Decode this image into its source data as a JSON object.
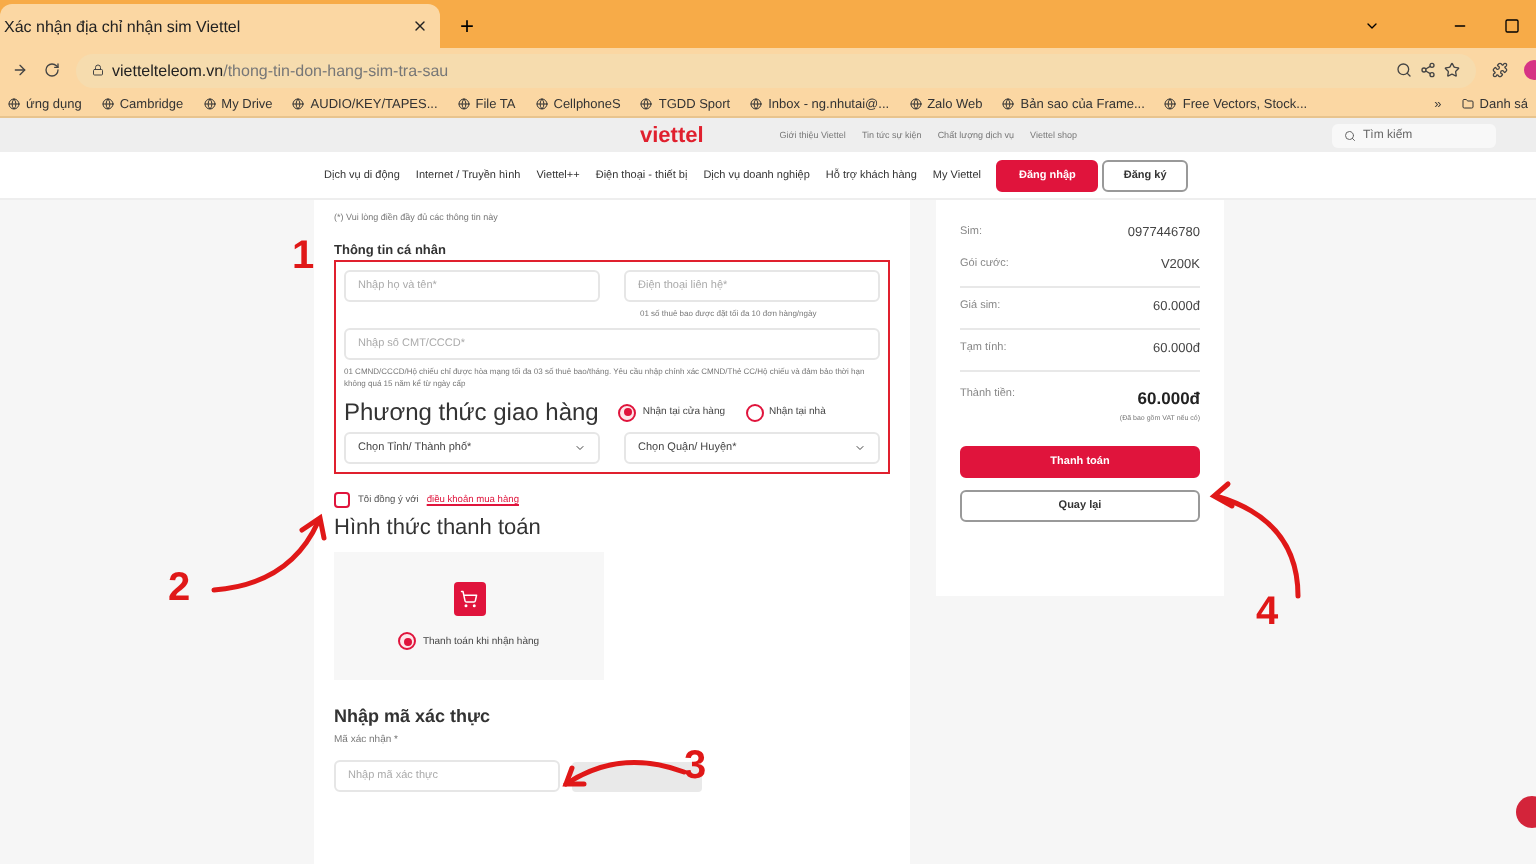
{
  "browser": {
    "tab_title": "Xác nhận địa chỉ nhận sim Viettel",
    "new_tab": "+",
    "url_domain": "viettelteleom.vn",
    "url_path": "/thong-tin-don-hang-sim-tra-sau",
    "bookmarks": [
      "ứng dụng",
      "Cambridge",
      "My Drive",
      "AUDIO/KEY/TAPES...",
      "File TA",
      "CellphoneS",
      "TGDD Sport",
      "Inbox - ng.nhutai@...",
      "Zalo Web",
      "Bản sao của Frame...",
      "Free Vectors, Stock..."
    ],
    "more": "»",
    "other_bookmarks": "Danh sá"
  },
  "header": {
    "logo": "viettel",
    "top_links": [
      "Giới thiệu Viettel",
      "Tin tức sự kiện",
      "Chất lượng dịch vụ",
      "Viettel shop"
    ],
    "search_placeholder": "Tìm kiếm",
    "nav": [
      "Dịch vụ di động",
      "Internet / Truyền hình",
      "Viettel++",
      "Điện thoại - thiết bị",
      "Dịch vụ doanh nghiệp",
      "Hỗ trợ khách hàng",
      "My Viettel"
    ],
    "login": "Đăng nhập",
    "register": "Đăng ký"
  },
  "form": {
    "note": "(*) Vui lòng điền đầy đủ các thông tin này",
    "section_title": "Thông tin cá nhân",
    "name_placeholder": "Nhập họ và tên*",
    "phone_placeholder": "Điện thoại liên hệ*",
    "phone_hint": "01 số thuê bao được đặt tối đa 10 đơn hàng/ngày",
    "id_placeholder": "Nhập số CMT/CCCD*",
    "id_note": "01 CMND/CCCD/Hộ chiếu chỉ được hòa mạng tối đa 03 số thuê bao/tháng. Yêu cầu nhập chính xác CMND/Thẻ CC/Hộ chiếu và đảm bảo thời hạn không quá 15 năm kể từ ngày cấp",
    "delivery_title": "Phương thức giao hàng",
    "delivery_options": [
      {
        "label": "Nhận tại cửa hàng",
        "selected": true
      },
      {
        "label": "Nhận tại nhà",
        "selected": false
      }
    ],
    "selects": [
      "Chọn Tỉnh/ Thành phố*",
      "Chọn Quận/ Huyện*"
    ],
    "agree": {
      "checked": false,
      "text": "Tôi đồng ý với",
      "link": "điều khoản mua hàng"
    },
    "payment_title": "Hình thức thanh toán",
    "payment_options": [
      {
        "label": "Thanh toán khi nhận hàng",
        "selected": true
      }
    ],
    "captcha_title": "Nhập mã xác thực",
    "captcha_label": "Mã xác nhận *",
    "captcha_placeholder": "Nhập mã xác thực"
  },
  "summary": {
    "rows": [
      {
        "label": "Sim:",
        "value": "0977446780"
      },
      {
        "label": "Gói cước:",
        "value": "V200K"
      },
      {
        "label": "Giá sim:",
        "value": "60.000đ"
      },
      {
        "label": "Tạm tính:",
        "value": "60.000đ"
      }
    ],
    "total_label": "Thành tiền:",
    "total_value": "60.000đ",
    "total_note": "(Đã bao gồm VAT nếu có)",
    "pay_button": "Thanh toán",
    "back_button": "Quay lại"
  },
  "annotations": [
    "1",
    "2",
    "3",
    "4"
  ]
}
